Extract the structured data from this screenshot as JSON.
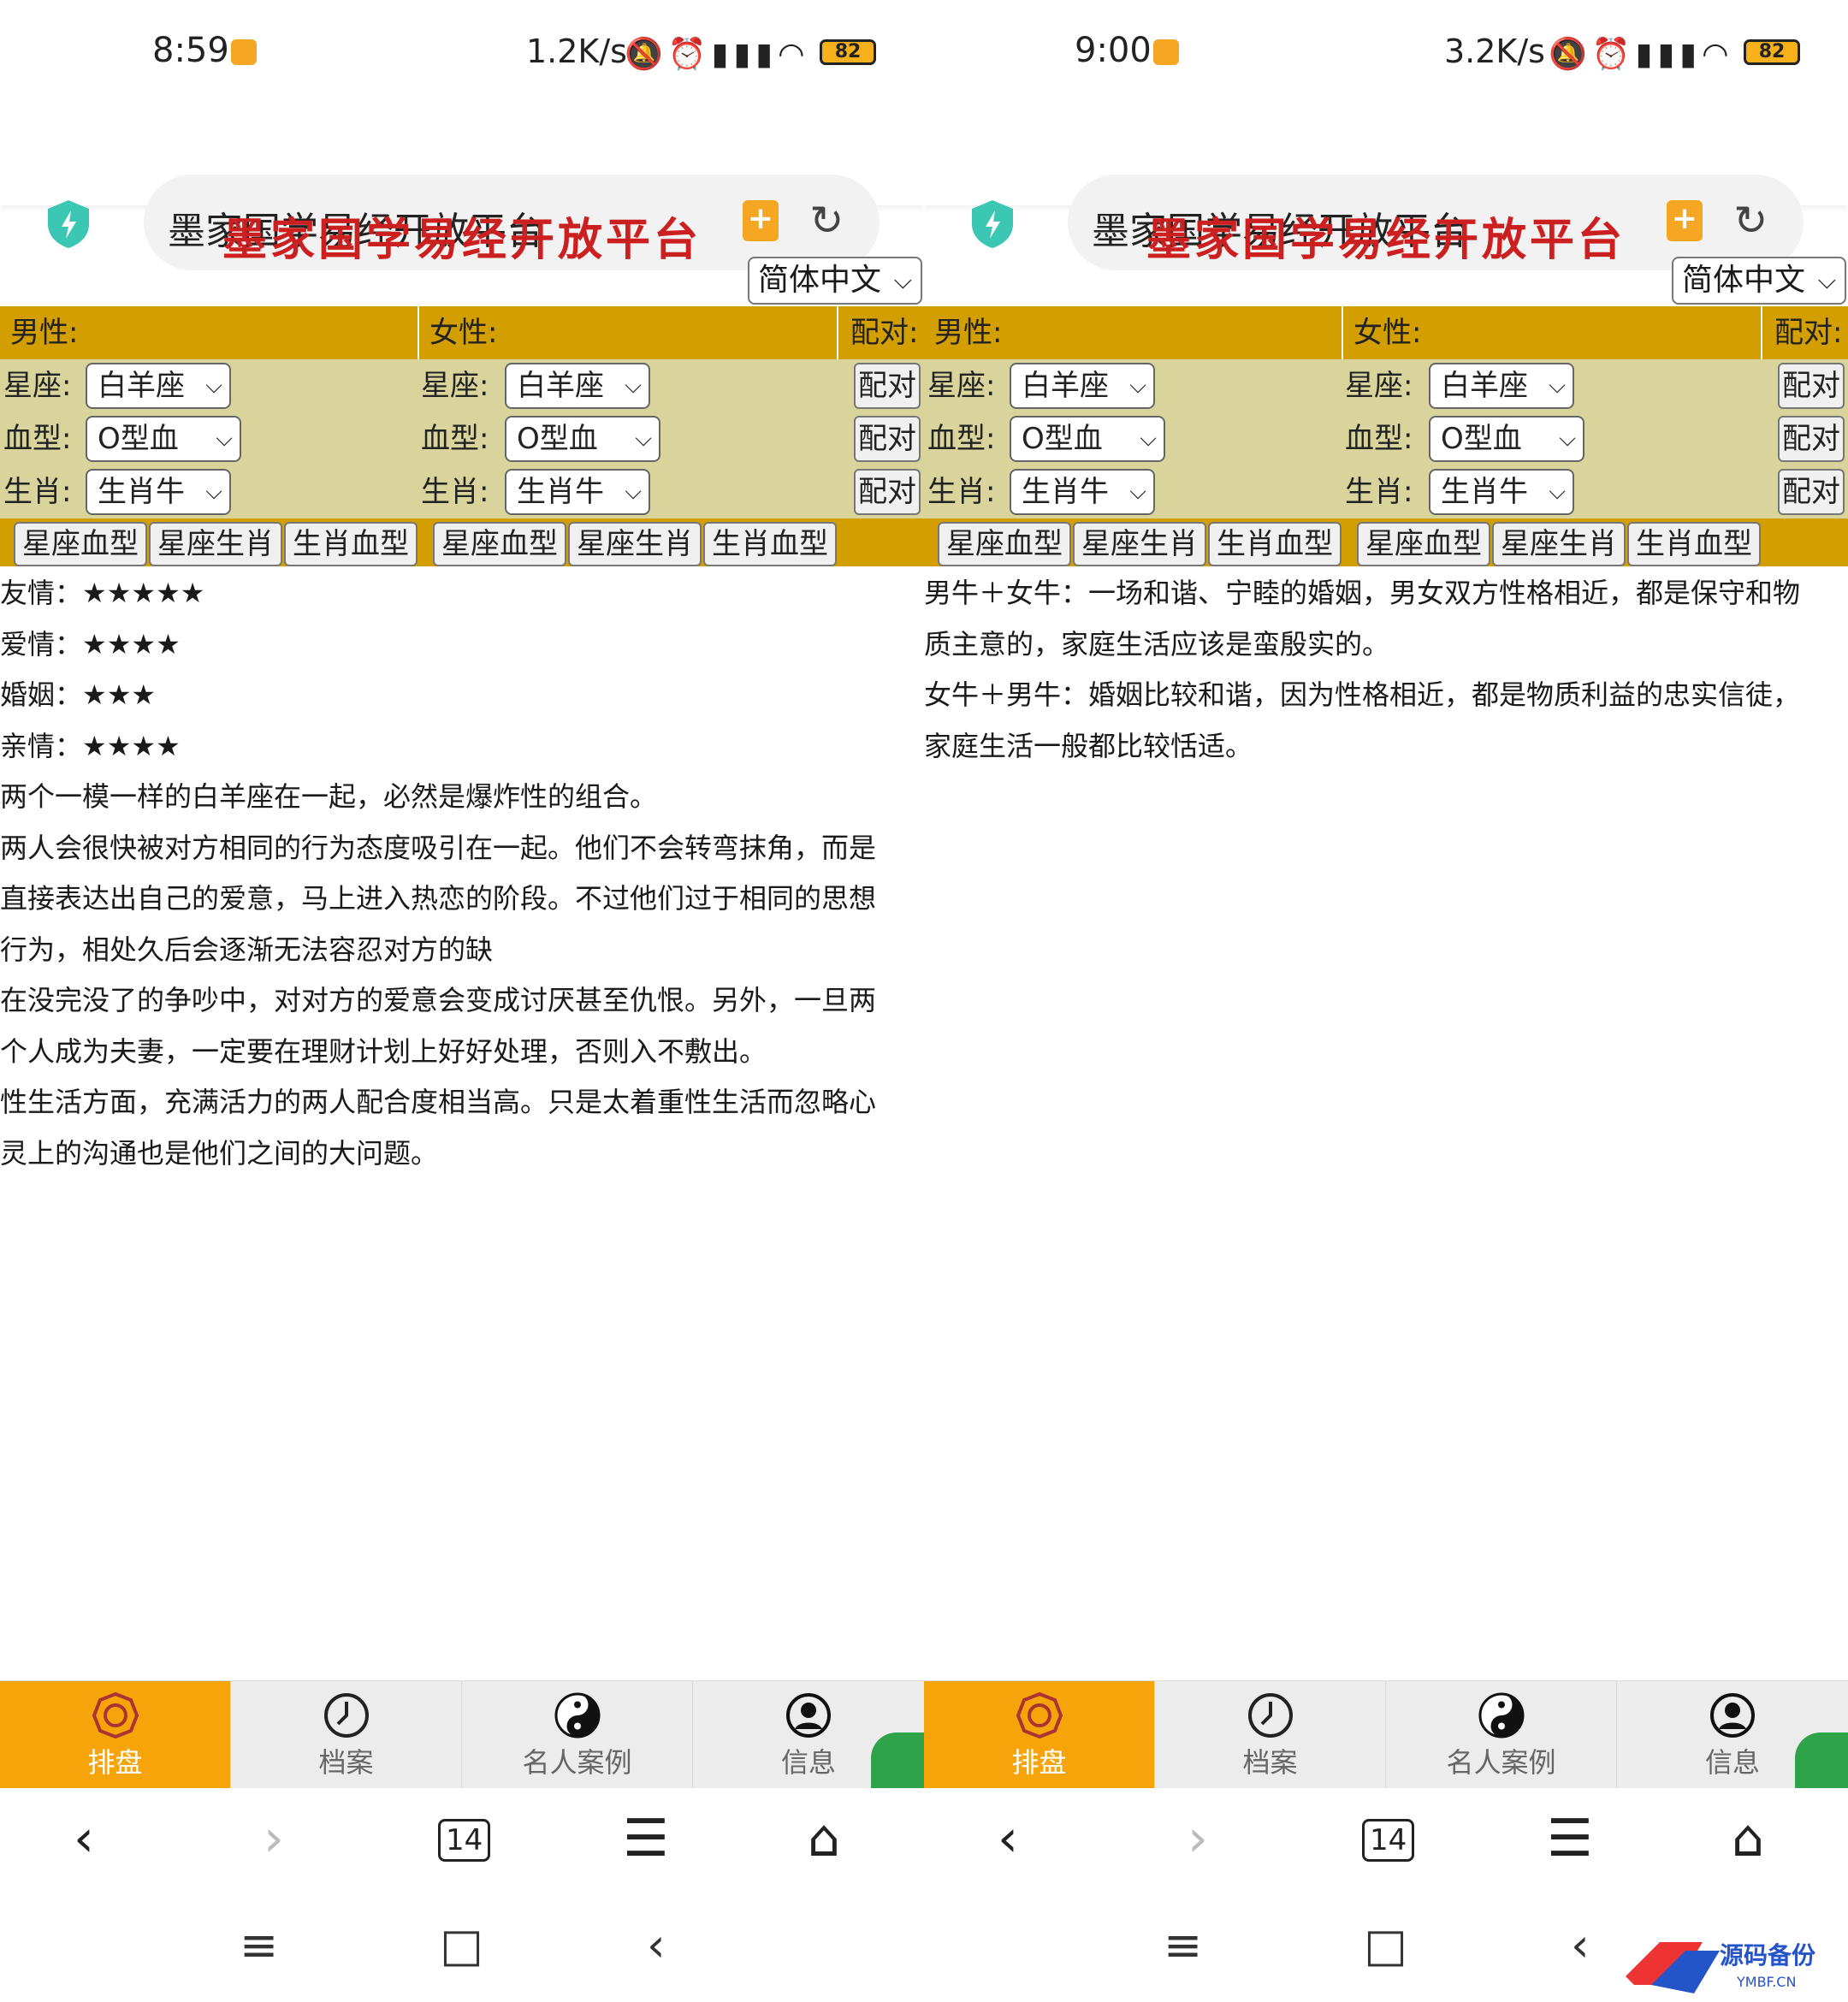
{
  "panels": [
    {
      "status": {
        "time": "8:59",
        "speed": "1.2K/s",
        "battery": "82"
      },
      "browser": {
        "url_title": "墨家国学易经开放平台"
      },
      "site_title": "墨家国学易经开放平台",
      "lang": "简体中文",
      "headers": {
        "male": "男性:",
        "female": "女性:",
        "pair": "配对:"
      },
      "rows": [
        {
          "label": "星座:",
          "male": "白羊座",
          "female": "白羊座",
          "button": "配对"
        },
        {
          "label": "血型:",
          "male": "O型血",
          "female": "O型血",
          "button": "配对"
        },
        {
          "label": "生肖:",
          "male": "生肖牛",
          "female": "生肖牛",
          "button": "配对"
        }
      ],
      "tabs": [
        "星座血型",
        "星座生肖",
        "生肖血型",
        "星座血型",
        "星座生肖",
        "生肖血型"
      ],
      "content": [
        "友情：★★★★★",
        "爱情：★★★★",
        "婚姻：★★★",
        "亲情：★★★★",
        "两个一模一样的白羊座在一起，必然是爆炸性的组合。",
        "两人会很快被对方相同的行为态度吸引在一起。他们不会转弯抹角，而是",
        "直接表达出自己的爱意，马上进入热恋的阶段。不过他们过于相同的思想",
        "行为，相处久后会逐渐无法容忍对方的缺",
        "在没完没了的争吵中，对对方的爱意会变成讨厌甚至仇恨。另外，一旦两",
        "个人成为夫妻，一定要在理财计划上好好处理，否则入不敷出。",
        "性生活方面，充满活力的两人配合度相当高。只是太着重性生活而忽略心",
        "灵上的沟通也是他们之间的大问题。"
      ],
      "nav": [
        "排盘",
        "档案",
        "名人案例",
        "信息"
      ],
      "tab_count": "14"
    },
    {
      "status": {
        "time": "9:00",
        "speed": "3.2K/s",
        "battery": "82"
      },
      "browser": {
        "url_title": "墨家国学易经开放平台"
      },
      "site_title": "墨家国学易经开放平台",
      "lang": "简体中文",
      "headers": {
        "male": "男性:",
        "female": "女性:",
        "pair": "配对:"
      },
      "rows": [
        {
          "label": "星座:",
          "male": "白羊座",
          "female": "白羊座",
          "button": "配对"
        },
        {
          "label": "血型:",
          "male": "O型血",
          "female": "O型血",
          "button": "配对"
        },
        {
          "label": "生肖:",
          "male": "生肖牛",
          "female": "生肖牛",
          "button": "配对"
        }
      ],
      "tabs": [
        "星座血型",
        "星座生肖",
        "生肖血型",
        "星座血型",
        "星座生肖",
        "生肖血型"
      ],
      "content": [
        "男牛＋女牛：一场和谐、宁睦的婚姻，男女双方性格相近，都是保守和物",
        "质主意的，家庭生活应该是蛮殷实的。",
        "女牛＋男牛：婚姻比较和谐，因为性格相近，都是物质利益的忠实信徒，",
        "家庭生活一般都比较恬适。"
      ],
      "nav": [
        "排盘",
        "档案",
        "名人案例",
        "信息"
      ],
      "tab_count": "14"
    }
  ],
  "watermark": {
    "text": "源码备份",
    "sub": "YMBF.CN"
  },
  "colors": {
    "title_red": "#cc1f1f",
    "gold": "#d39e00",
    "khaki": "#d8d49c",
    "orange": "#f7a30a"
  }
}
